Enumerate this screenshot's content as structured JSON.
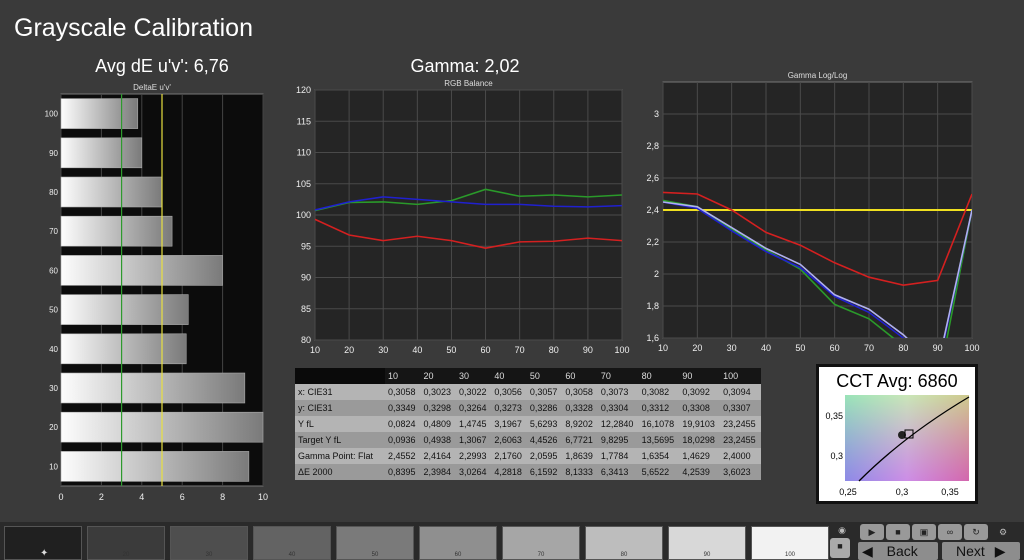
{
  "app": {
    "title": "Grayscale Calibration"
  },
  "delta_e_panel": {
    "heading": "Avg dE u'v': 6,76",
    "chart_data": {
      "type": "bar",
      "title": "DeltaE u'v'",
      "orientation": "horizontal",
      "categories": [
        "10",
        "20",
        "30",
        "40",
        "50",
        "60",
        "70",
        "80",
        "90",
        "100"
      ],
      "values": [
        9.3,
        10.0,
        9.1,
        6.2,
        6.3,
        8.0,
        5.5,
        5.0,
        4.0,
        3.8
      ],
      "xlim": [
        0,
        10
      ],
      "x_ticks": [
        "0",
        "2",
        "4",
        "6",
        "8",
        "10"
      ],
      "reference_lines": [
        {
          "value": 3,
          "color": "#2e9a2e"
        },
        {
          "value": 5,
          "color": "#e8e040"
        }
      ]
    }
  },
  "rgb_panel": {
    "heading": "Gamma: 2,02",
    "chart_data": {
      "type": "line",
      "title": "RGB Balance",
      "x": [
        10,
        20,
        30,
        40,
        50,
        60,
        70,
        80,
        90,
        100
      ],
      "ylim": [
        80,
        120
      ],
      "y_ticks": [
        "80",
        "85",
        "90",
        "95",
        "100",
        "105",
        "110",
        "115",
        "120"
      ],
      "x_ticks": [
        "10",
        "20",
        "30",
        "40",
        "50",
        "60",
        "70",
        "80",
        "90",
        "100"
      ],
      "series": [
        {
          "color": "#d42020",
          "values": [
            99.3,
            96.8,
            95.9,
            96.6,
            95.9,
            94.7,
            95.7,
            95.8,
            96.3,
            95.9
          ]
        },
        {
          "color": "#2a9a2a",
          "values": [
            100.7,
            102.0,
            102.1,
            101.7,
            102.3,
            104.1,
            103.0,
            103.2,
            102.9,
            103.2
          ]
        },
        {
          "color": "#2020d0",
          "values": [
            100.8,
            102.1,
            102.9,
            102.5,
            102.1,
            101.7,
            101.7,
            101.4,
            101.3,
            101.5
          ]
        }
      ]
    }
  },
  "gamma_panel": {
    "chart_data": {
      "type": "line",
      "title": "Gamma Log/Log",
      "x": [
        10,
        20,
        30,
        40,
        50,
        60,
        70,
        80,
        90,
        100
      ],
      "ylim": [
        1.6,
        3.2
      ],
      "y_ticks": [
        "1,6",
        "1,8",
        "2",
        "2,2",
        "2,4",
        "2,6",
        "2,8",
        "3"
      ],
      "x_ticks": [
        "10",
        "20",
        "30",
        "40",
        "50",
        "60",
        "70",
        "80",
        "90",
        "100"
      ],
      "target": {
        "value": 2.4,
        "color": "#f0e020"
      },
      "series": [
        {
          "color": "#d42020",
          "values": [
            2.51,
            2.5,
            2.4,
            2.26,
            2.18,
            2.07,
            1.98,
            1.93,
            1.96,
            2.5
          ]
        },
        {
          "color": "#2a9a2a",
          "values": [
            2.46,
            2.42,
            2.28,
            2.15,
            2.03,
            1.81,
            1.72,
            1.55,
            1.3,
            2.4
          ]
        },
        {
          "color": "#2020d0",
          "values": [
            2.45,
            2.41,
            2.27,
            2.14,
            2.04,
            1.86,
            1.76,
            1.6,
            1.4,
            2.4
          ]
        },
        {
          "color": "#b0b0ee",
          "values": [
            2.45,
            2.42,
            2.29,
            2.16,
            2.06,
            1.87,
            1.78,
            1.62,
            1.42,
            2.4
          ]
        }
      ]
    }
  },
  "table": {
    "header": [
      "",
      "10",
      "20",
      "30",
      "40",
      "50",
      "60",
      "70",
      "80",
      "90",
      "100"
    ],
    "rows": [
      [
        "x: CIE31",
        "0,3058",
        "0,3023",
        "0,3022",
        "0,3056",
        "0,3057",
        "0,3058",
        "0,3073",
        "0,3082",
        "0,3092",
        "0,3094"
      ],
      [
        "y: CIE31",
        "0,3349",
        "0,3298",
        "0,3264",
        "0,3273",
        "0,3286",
        "0,3328",
        "0,3304",
        "0,3312",
        "0,3308",
        "0,3307"
      ],
      [
        "Y fL",
        "0,0824",
        "0,4809",
        "1,4745",
        "3,1967",
        "5,6293",
        "8,9202",
        "12,2840",
        "16,1078",
        "19,9103",
        "23,2455"
      ],
      [
        "Target Y fL",
        "0,0936",
        "0,4938",
        "1,3067",
        "2,6063",
        "4,4526",
        "6,7721",
        "9,8295",
        "13,5695",
        "18,0298",
        "23,2455"
      ],
      [
        "Gamma Point: Flat",
        "2,4552",
        "2,4164",
        "2,2993",
        "2,1760",
        "2,0595",
        "1,8639",
        "1,7784",
        "1,6354",
        "1,4629",
        "2,4000"
      ],
      [
        "ΔE 2000",
        "0,8395",
        "2,3984",
        "3,0264",
        "4,2818",
        "6,1592",
        "8,1333",
        "6,3413",
        "5,6522",
        "4,2539",
        "3,6023"
      ]
    ]
  },
  "cct": {
    "heading": "CCT Avg: 6860",
    "x_ticks": [
      "0,25",
      "0,3",
      "0,35"
    ],
    "y_ticks": [
      "0,35",
      "0,3"
    ]
  },
  "swatches": [
    {
      "label": "",
      "color": "#202020"
    },
    {
      "label": "20",
      "color": "#3b3b3b"
    },
    {
      "label": "30",
      "color": "#4e4e4e"
    },
    {
      "label": "40",
      "color": "#636363"
    },
    {
      "label": "50",
      "color": "#7a7a7a"
    },
    {
      "label": "60",
      "color": "#8f8f8f"
    },
    {
      "label": "70",
      "color": "#a6a6a6"
    },
    {
      "label": "80",
      "color": "#bdbdbd"
    },
    {
      "label": "90",
      "color": "#d8d8d8"
    },
    {
      "label": "100",
      "color": "#f2f2f2"
    }
  ],
  "nav": {
    "back": "Back",
    "next": "Next"
  },
  "icons": [
    "eye-icon",
    "stop-icon",
    "play-icon",
    "save-icon",
    "glasses-icon",
    "refresh-icon",
    "settings-icon",
    "target-icon"
  ]
}
